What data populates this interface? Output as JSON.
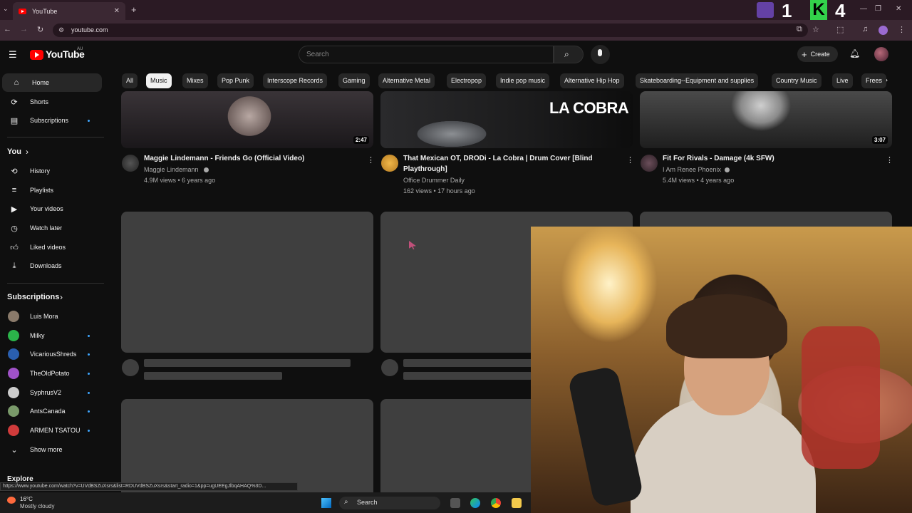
{
  "browser": {
    "tab_title": "YouTube",
    "url": "youtube.com",
    "status_url": "https://www.youtube.com/watch?v=UVdBSZuXsrs&list=RDUVdBSZuXsrs&start_radio=1&pp=ugUEEgJlbqAHAQ%3D..."
  },
  "overlay": {
    "count1": "1",
    "k_label": "K",
    "count2": "4"
  },
  "header": {
    "logo_text": "YouTube",
    "region": "AU",
    "search_placeholder": "Search",
    "create_label": "Create"
  },
  "chips": [
    "All",
    "Music",
    "Mixes",
    "Pop Punk",
    "Interscope Records",
    "Gaming",
    "Alternative Metal",
    "Electropop",
    "Indie pop music",
    "Alternative Hip Hop",
    "Skateboarding--Equipment and supplies",
    "Country Music",
    "Live",
    "Frees"
  ],
  "sidebar": {
    "main": [
      "Home",
      "Shorts",
      "Subscriptions"
    ],
    "you_label": "You",
    "you_items": [
      "History",
      "Playlists",
      "Your videos",
      "Watch later",
      "Liked videos",
      "Downloads"
    ],
    "subs_label": "Subscriptions",
    "subs": [
      "Luis Mora",
      "Milky",
      "VicariousShreds",
      "TheOldPotato",
      "SyphrusV2",
      "AntsCanada",
      "ARMEN TSATOU"
    ],
    "show_more": "Show more",
    "explore": "Explore"
  },
  "videos": [
    {
      "title": "Maggie Lindemann - Friends Go (Official Video)",
      "channel": "Maggie Lindemann",
      "meta": "4.9M views • 6 years ago",
      "duration": "2:47"
    },
    {
      "title_line1": "That Mexican OT, DRODi - La Cobra | Drum Cover [Blind",
      "title_line2": "Playthrough]",
      "channel": "Office Drummer Daily",
      "meta": "162 views • 17 hours ago",
      "thumb_text": "LA COBRA"
    },
    {
      "title": "Fit For Rivals - Damage (4k SFW)",
      "channel": "I Am Renee Phoenix",
      "meta": "5.4M views • 4 years ago",
      "duration": "3:07"
    }
  ],
  "taskbar": {
    "temp": "16°C",
    "weather": "Mostly cloudy",
    "search": "Search"
  },
  "colors": {
    "bg": "#0f0f0f",
    "accent_red": "#ff0000",
    "dot_blue": "#3ea6ff",
    "twitch": "#6441a5",
    "k_green": "#33d14b"
  }
}
